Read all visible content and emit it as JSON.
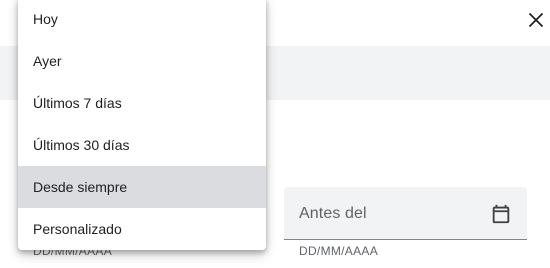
{
  "dialog": {
    "close_icon": "close-icon",
    "end_date": {
      "label": "Antes del",
      "icon": "calendar-icon",
      "hint": "DD/MM/AAAA"
    },
    "start_date": {
      "hint": "DD/MM/AAAA"
    }
  },
  "menu": {
    "selected_index": 4,
    "items": [
      {
        "label": "Hoy"
      },
      {
        "label": "Ayer"
      },
      {
        "label": "Últimos 7 días"
      },
      {
        "label": "Últimos 30 días"
      },
      {
        "label": "Desde siempre"
      },
      {
        "label": "Personalizado"
      }
    ]
  },
  "colors": {
    "selected_bg": "#dadce0",
    "field_bg": "#f1f3f4",
    "text": "#202124",
    "secondary_text": "#5f6368"
  }
}
